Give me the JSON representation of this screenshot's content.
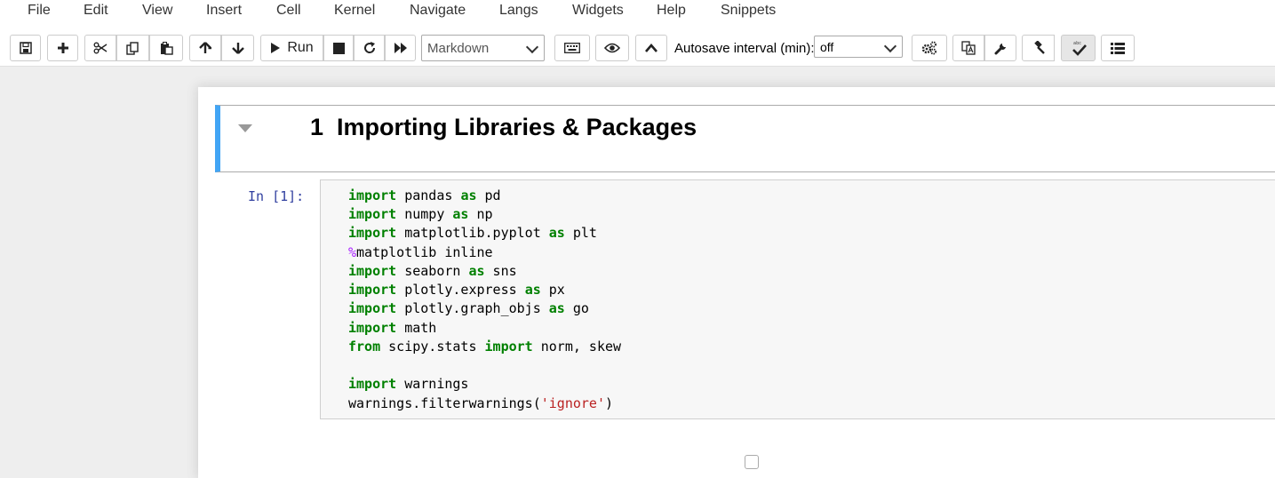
{
  "menu": [
    "File",
    "Edit",
    "View",
    "Insert",
    "Cell",
    "Kernel",
    "Navigate",
    "Langs",
    "Widgets",
    "Help",
    "Snippets"
  ],
  "toolbar": {
    "run_label": "Run",
    "cell_type": "Markdown",
    "autosave_label": "Autosave interval (min):",
    "autosave_value": "off"
  },
  "icons": [
    "save-icon",
    "plus-icon",
    "cut-icon",
    "copy-icon",
    "paste-icon",
    "arrow-up-icon",
    "arrow-down-icon",
    "play-icon",
    "stop-icon",
    "restart-icon",
    "fast-forward-icon",
    "keyboard-icon",
    "eye-icon",
    "chevron-up-icon",
    "gears-icon",
    "translate-icon",
    "wrench-icon",
    "gavel-icon",
    "spellcheck-icon",
    "list-icon"
  ],
  "notebook": {
    "heading_number": "1",
    "heading_text": "Importing Libraries & Packages",
    "prompt": "In [1]:",
    "code": [
      {
        "kw": "import",
        "rest": " pandas ",
        "kw2": "as",
        "rest2": " pd"
      },
      {
        "kw": "import",
        "rest": " numpy ",
        "kw2": "as",
        "rest2": " np"
      },
      {
        "kw": "import",
        "rest": " matplotlib.pyplot ",
        "kw2": "as",
        "rest2": " plt"
      },
      {
        "magic": "%",
        "rest": "matplotlib inline"
      },
      {
        "kw": "import",
        "rest": " seaborn ",
        "kw2": "as",
        "rest2": " sns"
      },
      {
        "kw": "import",
        "rest": " plotly.express ",
        "kw2": "as",
        "rest2": " px"
      },
      {
        "kw": "import",
        "rest": " plotly.graph_objs ",
        "kw2": "as",
        "rest2": " go"
      },
      {
        "kw": "import",
        "rest": " math"
      },
      {
        "kw": "from",
        "rest": " scipy.stats ",
        "kw2": "import",
        "rest2": " norm, skew"
      },
      {
        "blank": ""
      },
      {
        "kw": "import",
        "rest": " warnings"
      },
      {
        "rest": "warnings.filterwarnings(",
        "str": "'ignore'",
        "rest2": ")"
      }
    ]
  }
}
